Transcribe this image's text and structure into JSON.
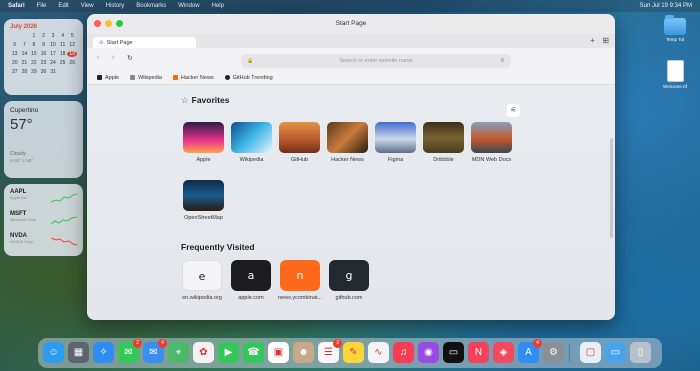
{
  "menubar": {
    "left": [
      "Safari",
      "File",
      "Edit",
      "View",
      "History",
      "Bookmarks",
      "Window",
      "Help"
    ],
    "right": "Sun Jul 19  9:34 PM"
  },
  "calendar": {
    "month": "July 2026",
    "days": [
      "",
      "",
      "1",
      "2",
      "3",
      "4",
      "5",
      "6",
      "7",
      "8",
      "9",
      "10",
      "11",
      "12",
      "13",
      "14",
      "15",
      "16",
      "17",
      "18",
      "19",
      "20",
      "21",
      "22",
      "23",
      "24",
      "25",
      "26",
      "27",
      "28",
      "29",
      "30",
      "31"
    ],
    "today": "19"
  },
  "weather": {
    "city": "Cupertino",
    "temp": "57°",
    "condition": "Cloudy",
    "hilo": "H:60° L:58°"
  },
  "stocks": [
    {
      "symbol": "AAPL",
      "name": "Apple Inc.",
      "trend": "up",
      "color": "#34c759"
    },
    {
      "symbol": "MSFT",
      "name": "Microsoft Corp.",
      "trend": "up",
      "color": "#34c759"
    },
    {
      "symbol": "NVDA",
      "name": "NVIDIA Corp.",
      "trend": "down",
      "color": "#ff3b30"
    }
  ],
  "desktop": {
    "folder_label": "Temp Tol",
    "doc_label": "Welcome.rtf"
  },
  "window": {
    "title": "Start Page",
    "tab_label": "Start Page",
    "address_placeholder": "Search or enter website name"
  },
  "bookmarks": [
    {
      "label": "Apple",
      "color": "#222"
    },
    {
      "label": "Wikipedia",
      "color": "#666"
    },
    {
      "label": "Hacker News",
      "color": "#ff6600"
    },
    {
      "label": "GitHub Trending",
      "color": "#222"
    }
  ],
  "favorites_title": "Favorites",
  "favorites": [
    {
      "label": "Apple",
      "gradient": "linear-gradient(#2a1b4a,#e8348a 60%,#ffa34d)"
    },
    {
      "label": "Wikipedia",
      "gradient": "linear-gradient(135deg,#0d4f8a,#3fb6e8 50%,#e6f4fa)"
    },
    {
      "label": "GitHub",
      "gradient": "linear-gradient(#e29445,#b5562a 60%,#6d2f18)"
    },
    {
      "label": "Hacker News",
      "gradient": "linear-gradient(135deg,#5a3a1e,#c77a3a 50%,#2b1a10)"
    },
    {
      "label": "Figma",
      "gradient": "linear-gradient(#3f6bd1,#cfd9e8 55%,#5a6f8a)"
    },
    {
      "label": "Dribbble",
      "gradient": "linear-gradient(#3a2f1a,#7a6333 50%,#4a3a20)"
    },
    {
      "label": "MDN Web Docs",
      "gradient": "linear-gradient(#8aa0b8,#c2562a 55%,#3b4a55)"
    },
    {
      "label": "OpenStreetMap",
      "gradient": "linear-gradient(#0d2a4a,#1b5a8a 50%,#2a1b10)"
    }
  ],
  "frequent_title": "Frequently Visited",
  "frequent": [
    {
      "letter": "e",
      "label": "en.wikipedia.org",
      "bg": "#f4f4f6",
      "fg": "#222"
    },
    {
      "letter": "a",
      "label": "apple.com",
      "bg": "#1c1c1e",
      "fg": "#fff"
    },
    {
      "letter": "n",
      "label": "news.ycombinat...",
      "bg": "#ff6a1a",
      "fg": "#fff"
    },
    {
      "letter": "g",
      "label": "github.com",
      "bg": "#24292f",
      "fg": "#fff"
    }
  ],
  "dock": [
    {
      "name": "finder",
      "bg": "#2c9bf0",
      "glyph": "☺"
    },
    {
      "name": "launchpad",
      "bg": "#5d6470",
      "glyph": "▦"
    },
    {
      "name": "safari",
      "bg": "#2f8cf5",
      "glyph": "✧"
    },
    {
      "name": "messages",
      "bg": "#34c759",
      "glyph": "✉",
      "badge": "2"
    },
    {
      "name": "mail",
      "bg": "#3a8ef0",
      "glyph": "✉",
      "badge": "4"
    },
    {
      "name": "maps",
      "bg": "#4cb96a",
      "glyph": "⌖"
    },
    {
      "name": "photos",
      "bg": "#f2f2f2",
      "glyph": "✿"
    },
    {
      "name": "facetime",
      "bg": "#34c759",
      "glyph": "▶"
    },
    {
      "name": "phone",
      "bg": "#34c759",
      "glyph": "☎"
    },
    {
      "name": "calendar",
      "bg": "#ffffff",
      "glyph": "▣"
    },
    {
      "name": "contacts",
      "bg": "#c9a78a",
      "glyph": "☻"
    },
    {
      "name": "reminders",
      "bg": "#f6f6f6",
      "glyph": "☰",
      "badge": "3"
    },
    {
      "name": "notes",
      "bg": "#ffd43b",
      "glyph": "✎"
    },
    {
      "name": "freeform",
      "bg": "#f4f4f4",
      "glyph": "∿"
    },
    {
      "name": "music",
      "bg": "#fa3b54",
      "glyph": "♫"
    },
    {
      "name": "podcasts",
      "bg": "#9a4ce0",
      "glyph": "◉"
    },
    {
      "name": "tv",
      "bg": "#111111",
      "glyph": "▭"
    },
    {
      "name": "news",
      "bg": "#f5405a",
      "glyph": "N"
    },
    {
      "name": "games",
      "bg": "#f2495f",
      "glyph": "◈"
    },
    {
      "name": "app-store",
      "bg": "#2f8cf5",
      "glyph": "A",
      "badge": "4"
    },
    {
      "name": "system-settings",
      "bg": "#8a8f98",
      "glyph": "⚙"
    },
    {
      "name": "preview",
      "bg": "#e8eef6",
      "glyph": "▢"
    },
    {
      "name": "downloads-folder",
      "bg": "#4aa4ec",
      "glyph": "▭"
    },
    {
      "name": "trash",
      "bg": "#b8c2cc",
      "glyph": "▯"
    }
  ]
}
